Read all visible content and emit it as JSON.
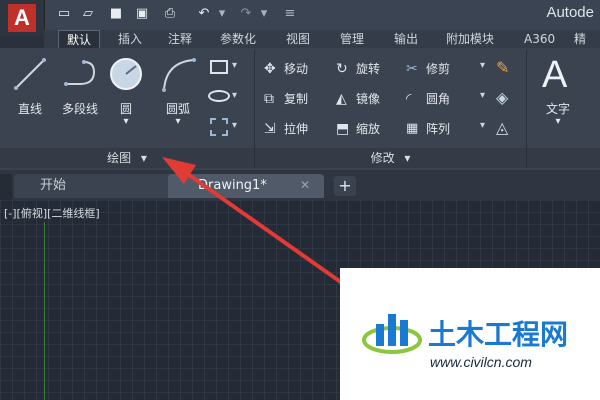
{
  "app": {
    "title": "Autode"
  },
  "ribbon_tabs": [
    "默认",
    "插入",
    "注释",
    "参数化",
    "视图",
    "管理",
    "输出",
    "附加模块",
    "A360",
    "精"
  ],
  "draw_panel": {
    "line_label": "直线",
    "polyline_label": "多段线",
    "circle_label": "圆",
    "arc_label": "圆弧",
    "panel_title": "绘图"
  },
  "modify_panel": {
    "move": "移动",
    "rotate": "旋转",
    "trim": "修剪",
    "copy": "复制",
    "mirror": "镜像",
    "fillet": "圆角",
    "stretch": "拉伸",
    "scale": "缩放",
    "array": "阵列",
    "panel_title": "修改"
  },
  "annotation_panel": {
    "text_label": "文字"
  },
  "doc_tabs": {
    "start": "开始",
    "drawing": "Drawing1*",
    "add": "+"
  },
  "viewport": {
    "label": "[-][俯视][二维线框]"
  },
  "watermark": {
    "name": "土木工程网",
    "url": "www.civilcn.com"
  },
  "colors": {
    "accent_red": "#e23b36",
    "app_red": "#c0302b",
    "logo_blue": "#1a7ad1"
  }
}
